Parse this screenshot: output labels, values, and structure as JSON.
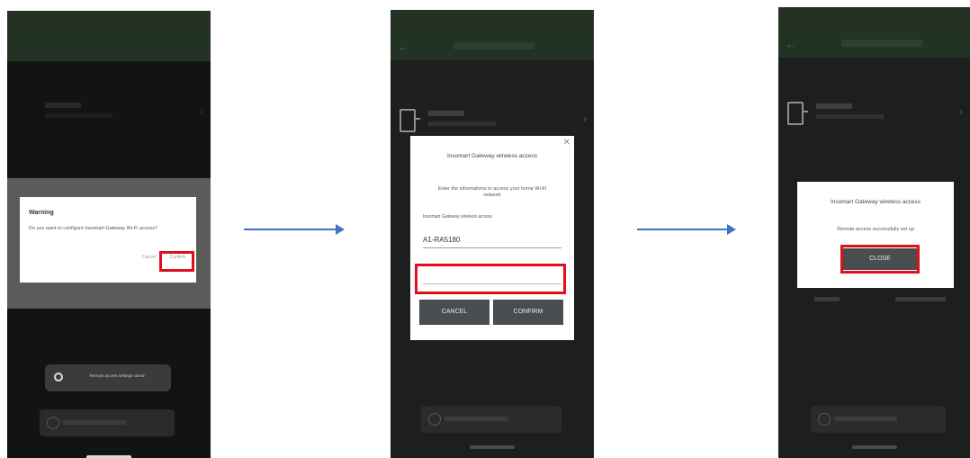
{
  "screen1": {
    "dialog_title": "Warning",
    "dialog_message": "Do you want to configure Insomart Gateway Wi-Fi access?",
    "cancel_label": "Cancel",
    "confirm_label": "Confirm",
    "remote_button_label": "Remote access settings saved"
  },
  "screen2": {
    "dialog_title": "Insomart Gateway wireless access",
    "instruction": "Enter the informations to access your home Wi-Fi network",
    "field_label": "Insomart Gateway wireless access",
    "network_value": "A1-RA5180",
    "password_placeholder": "",
    "cancel_label": "CANCEL",
    "confirm_label": "CONFIRM"
  },
  "screen3": {
    "dialog_title": "Insomart Gateway wireless access",
    "message": "Remote access successfully set up",
    "close_label": "CLOSE"
  },
  "colors": {
    "highlight": "#e0101a",
    "arrow": "#4472c4",
    "app_bar": "#243226"
  }
}
